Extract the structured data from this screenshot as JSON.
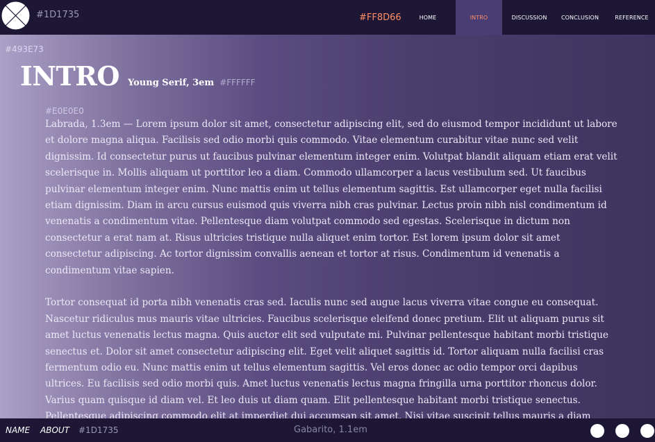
{
  "header": {
    "logo_icon": "crossed-circle-logo-icon",
    "color_hex": "#1D1735",
    "accent_hex": "#FF8D66",
    "nav": [
      {
        "label": "HOME",
        "active": false
      },
      {
        "label": "INTRO",
        "active": true
      },
      {
        "label": "DISCUSSION",
        "active": false
      },
      {
        "label": "CONCLUSION",
        "active": false
      },
      {
        "label": "REFERENCE",
        "active": false
      }
    ]
  },
  "main": {
    "bg_hex": "#493E73",
    "title": "INTRO",
    "title_font_spec": "Young Serif, 3em",
    "title_color_hex": "#FFFFFF",
    "body_color_hex": "#E0E0E0",
    "paragraphs": [
      "Labrada, 1.3em — Lorem ipsum dolor sit amet, consectetur adipiscing elit, sed do eiusmod tempor incididunt ut labore et dolore magna aliqua. Facilisis sed odio morbi quis commodo. Vitae elementum curabitur vitae nunc sed velit dignissim. Id consectetur purus ut faucibus pulvinar elementum integer enim. Volutpat blandit aliquam etiam erat velit scelerisque in. Mollis aliquam ut porttitor leo a diam. Commodo ullamcorper a lacus vestibulum sed. Ut faucibus pulvinar elementum integer enim. Nunc mattis enim ut tellus elementum sagittis. Est ullamcorper eget nulla facilisi etiam dignissim. Diam in arcu cursus euismod quis viverra nibh cras pulvinar. Lectus proin nibh nisl condimentum id venenatis a condimentum vitae. Pellentesque diam volutpat commodo sed egestas. Scelerisque in dictum non consectetur a erat nam at. Risus ultricies tristique nulla aliquet enim tortor. Est lorem ipsum dolor sit amet consectetur adipiscing. Ac tortor dignissim convallis aenean et tortor at risus. Condimentum id venenatis a condimentum vitae sapien.",
      "Tortor consequat id porta nibh venenatis cras sed. Iaculis nunc sed augue lacus viverra vitae congue eu consequat. Nascetur ridiculus mus mauris vitae ultricies. Faucibus scelerisque eleifend donec pretium. Elit ut aliquam purus sit amet luctus venenatis lectus magna. Quis auctor elit sed vulputate mi. Pulvinar pellentesque habitant morbi tristique senectus et. Dolor sit amet consectetur adipiscing elit. Eget velit aliquet sagittis id. Tortor aliquam nulla facilisi cras fermentum odio eu. Nunc mattis enim ut tellus elementum sagittis. Vel eros donec ac odio tempor orci dapibus ultrices. Eu facilisis sed odio morbi quis. Amet luctus venenatis lectus magna fringilla urna porttitor rhoncus dolor. Varius quam quisque id diam vel. Et leo duis ut diam quam. Elit pellentesque habitant morbi tristique senectus. Pellentesque adipiscing commodo elit at imperdiet dui accumsan sit amet. Nisi vitae suscipit tellus mauris a diam maecenas."
    ]
  },
  "footer": {
    "name_label": "NAME",
    "about_label": "ABOUT",
    "color_hex": "#1D1735",
    "font_spec": "Gabarito, 1.1em",
    "circle_count": 3
  }
}
